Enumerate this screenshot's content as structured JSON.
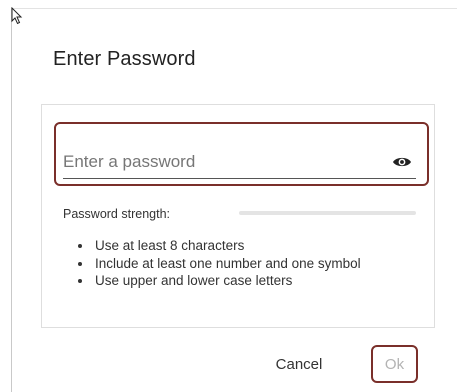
{
  "dialog": {
    "title": "Enter Password"
  },
  "password_field": {
    "placeholder": "Enter a password",
    "value": ""
  },
  "icons": {
    "cursor": "mouse-pointer-icon",
    "visibility_toggle": "eye-icon"
  },
  "strength": {
    "label": "Password strength:",
    "level": 0
  },
  "rules": [
    "Use at least 8 characters",
    "Include at least one number and one symbol",
    "Use upper and lower case letters"
  ],
  "actions": {
    "cancel_label": "Cancel",
    "ok_label": "Ok",
    "ok_enabled": false
  },
  "colors": {
    "focus_accent": "#7a2f2a",
    "disabled_text": "#b3b3b3"
  }
}
